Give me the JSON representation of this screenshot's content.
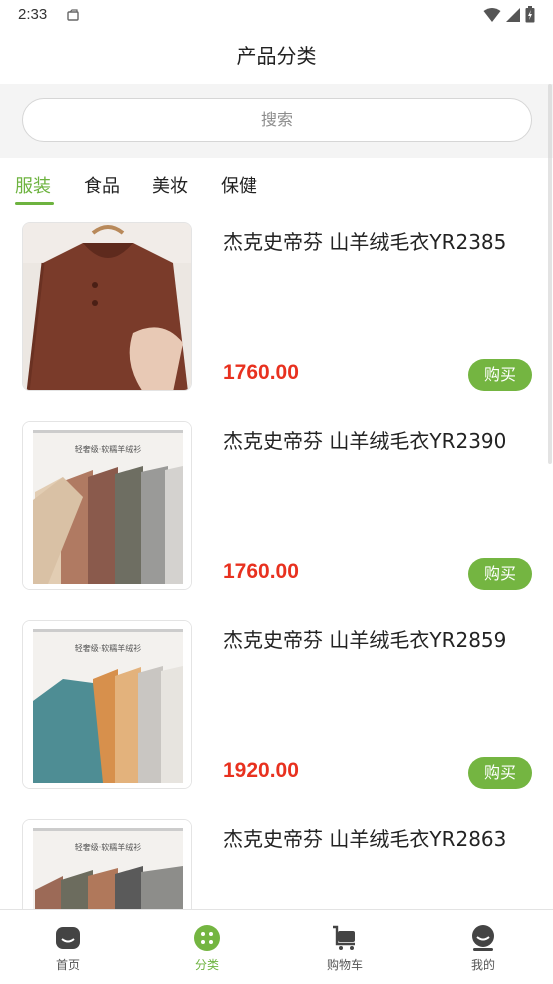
{
  "status_bar": {
    "time": "2:33"
  },
  "header": {
    "title": "产品分类"
  },
  "search": {
    "placeholder": "搜索"
  },
  "tabs": [
    {
      "label": "服装",
      "active": true
    },
    {
      "label": "食品",
      "active": false
    },
    {
      "label": "美妆",
      "active": false
    },
    {
      "label": "保健",
      "active": false
    }
  ],
  "products": [
    {
      "name": "杰克史帝芬 山羊绒毛衣YR2385",
      "price": "1760.00",
      "buy_label": "购买",
      "image": "brown-sweater-on-hanger"
    },
    {
      "name": "杰克史帝芬 山羊绒毛衣YR2390",
      "price": "1760.00",
      "buy_label": "购买",
      "image": "sweater-rack-beige-brown"
    },
    {
      "name": "杰克史帝芬 山羊绒毛衣YR2859",
      "price": "1920.00",
      "buy_label": "购买",
      "image": "sweater-rack-teal-orange"
    },
    {
      "name": "杰克史帝芬 山羊绒毛衣YR2863",
      "price": "",
      "buy_label": "",
      "image": "sweater-rack-dark"
    }
  ],
  "tabbar": [
    {
      "label": "首页",
      "icon": "home-icon",
      "active": false
    },
    {
      "label": "分类",
      "icon": "category-icon",
      "active": true
    },
    {
      "label": "购物车",
      "icon": "cart-icon",
      "active": false
    },
    {
      "label": "我的",
      "icon": "profile-icon",
      "active": false
    }
  ],
  "colors": {
    "accent": "#6db33f",
    "price": "#e8311f",
    "buy_button": "#74b541"
  }
}
